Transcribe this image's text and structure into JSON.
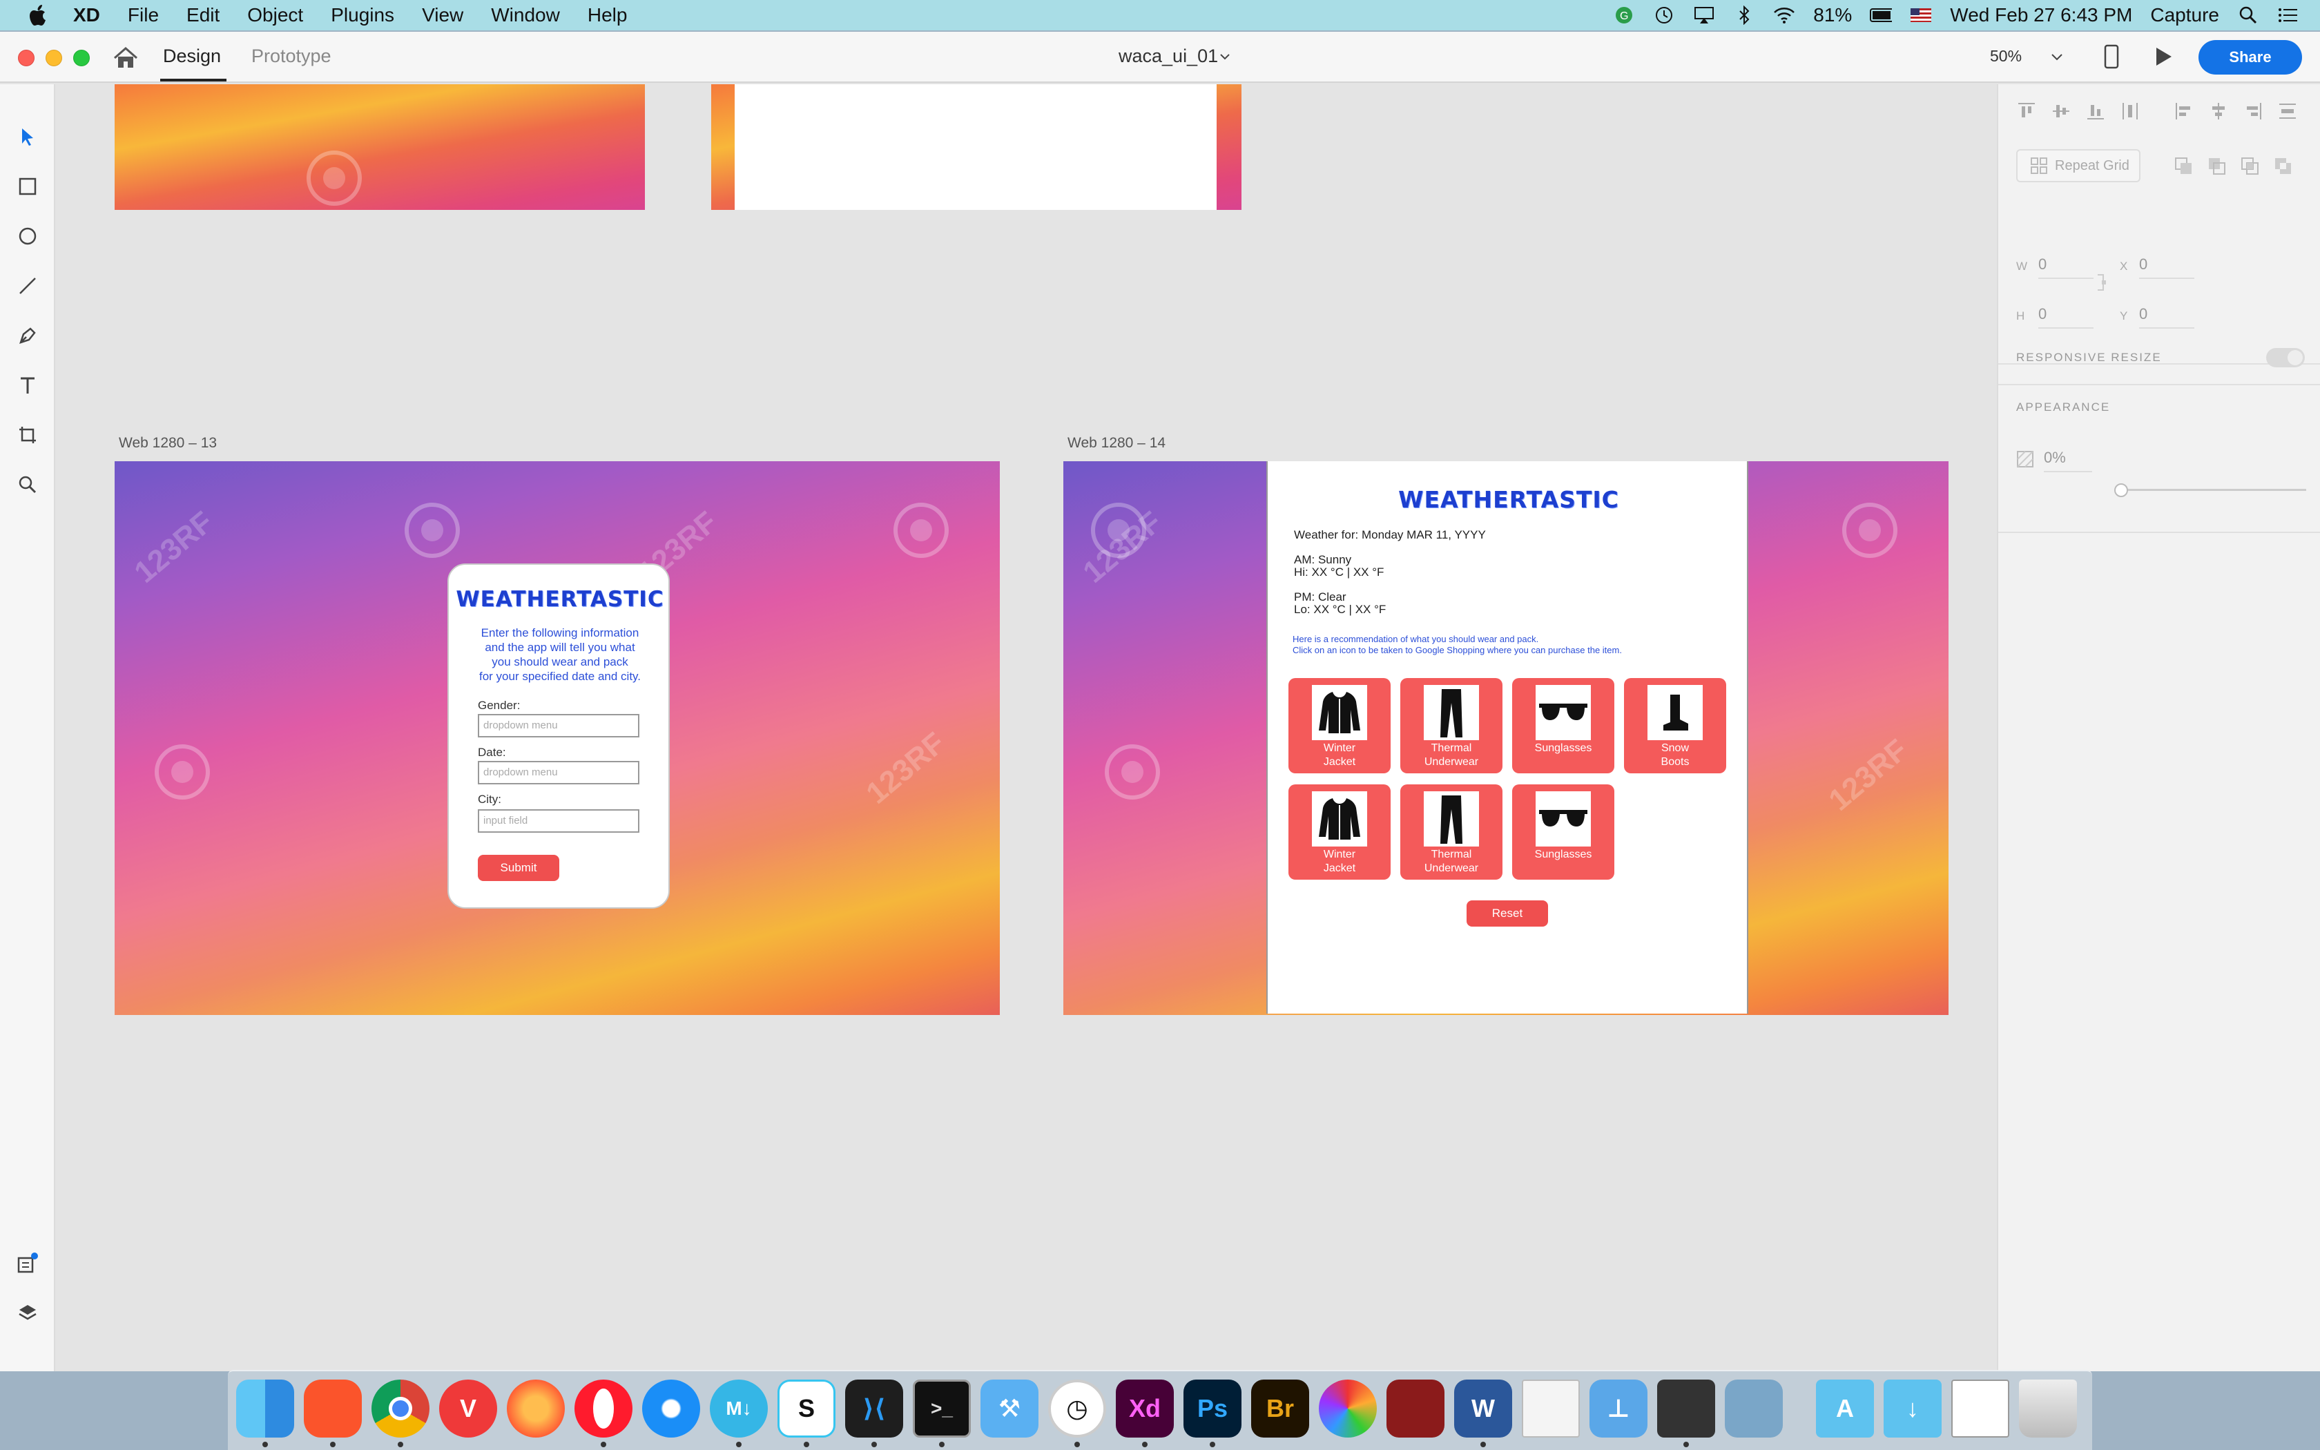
{
  "menubar": {
    "app_name": "XD",
    "menus": [
      "File",
      "Edit",
      "Object",
      "Plugins",
      "View",
      "Window",
      "Help"
    ],
    "battery": "81%",
    "clock": "Wed Feb 27  6:43 PM",
    "capture_label": "Capture"
  },
  "titlebar": {
    "tab_design": "Design",
    "tab_prototype": "Prototype",
    "document_title": "waca_ui_01",
    "zoom": "50%",
    "share_label": "Share"
  },
  "artboards": {
    "label_13": "Web 1280 – 13",
    "label_14": "Web 1280 – 14"
  },
  "login_screen": {
    "brand": "WEATHERTASTIC",
    "intro": [
      "Enter the following information",
      "and the app will tell you what",
      "you should wear and pack",
      "for your specified date and city."
    ],
    "gender_label": "Gender:",
    "gender_placeholder": "dropdown menu",
    "date_label": "Date:",
    "date_placeholder": "dropdown menu",
    "city_label": "City:",
    "city_placeholder": "input field",
    "submit_label": "Submit"
  },
  "results_screen": {
    "brand": "WEATHERTASTIC",
    "weather_for": "Weather for: Monday MAR 11, YYYY",
    "am_condition": "AM: Sunny",
    "hi": "Hi: XX °C | XX °F",
    "pm_condition": "PM: Clear",
    "lo": "Lo: XX °C | XX °F",
    "rec_line_1": "Here is a recommendation of what you should wear and pack.",
    "rec_line_2": "Click on an icon to be taken to Google Shopping where you can purchase the item.",
    "items": [
      {
        "label1": "Winter",
        "label2": "Jacket",
        "icon": "jacket-icon"
      },
      {
        "label1": "Thermal",
        "label2": "Underwear",
        "icon": "pants-icon"
      },
      {
        "label1": "Sunglasses",
        "label2": "",
        "icon": "sunglasses-icon"
      },
      {
        "label1": "Snow",
        "label2": "Boots",
        "icon": "boot-icon"
      },
      {
        "label1": "Winter",
        "label2": "Jacket",
        "icon": "jacket-icon"
      },
      {
        "label1": "Thermal",
        "label2": "Underwear",
        "icon": "pants-icon"
      },
      {
        "label1": "Sunglasses",
        "label2": "",
        "icon": "sunglasses-icon"
      }
    ],
    "reset_label": "Reset"
  },
  "watermark": "123RF",
  "properties": {
    "repeat_grid": "Repeat Grid",
    "w_label": "W",
    "w_value": "0",
    "h_label": "H",
    "h_value": "0",
    "x_label": "X",
    "x_value": "0",
    "y_label": "Y",
    "y_value": "0",
    "responsive_resize": "RESPONSIVE RESIZE",
    "appearance": "APPEARANCE",
    "opacity": "0%"
  },
  "colors": {
    "accent": "#1473e6",
    "brand_blue": "#1d3fcf",
    "button_red": "#ef4f4f"
  }
}
